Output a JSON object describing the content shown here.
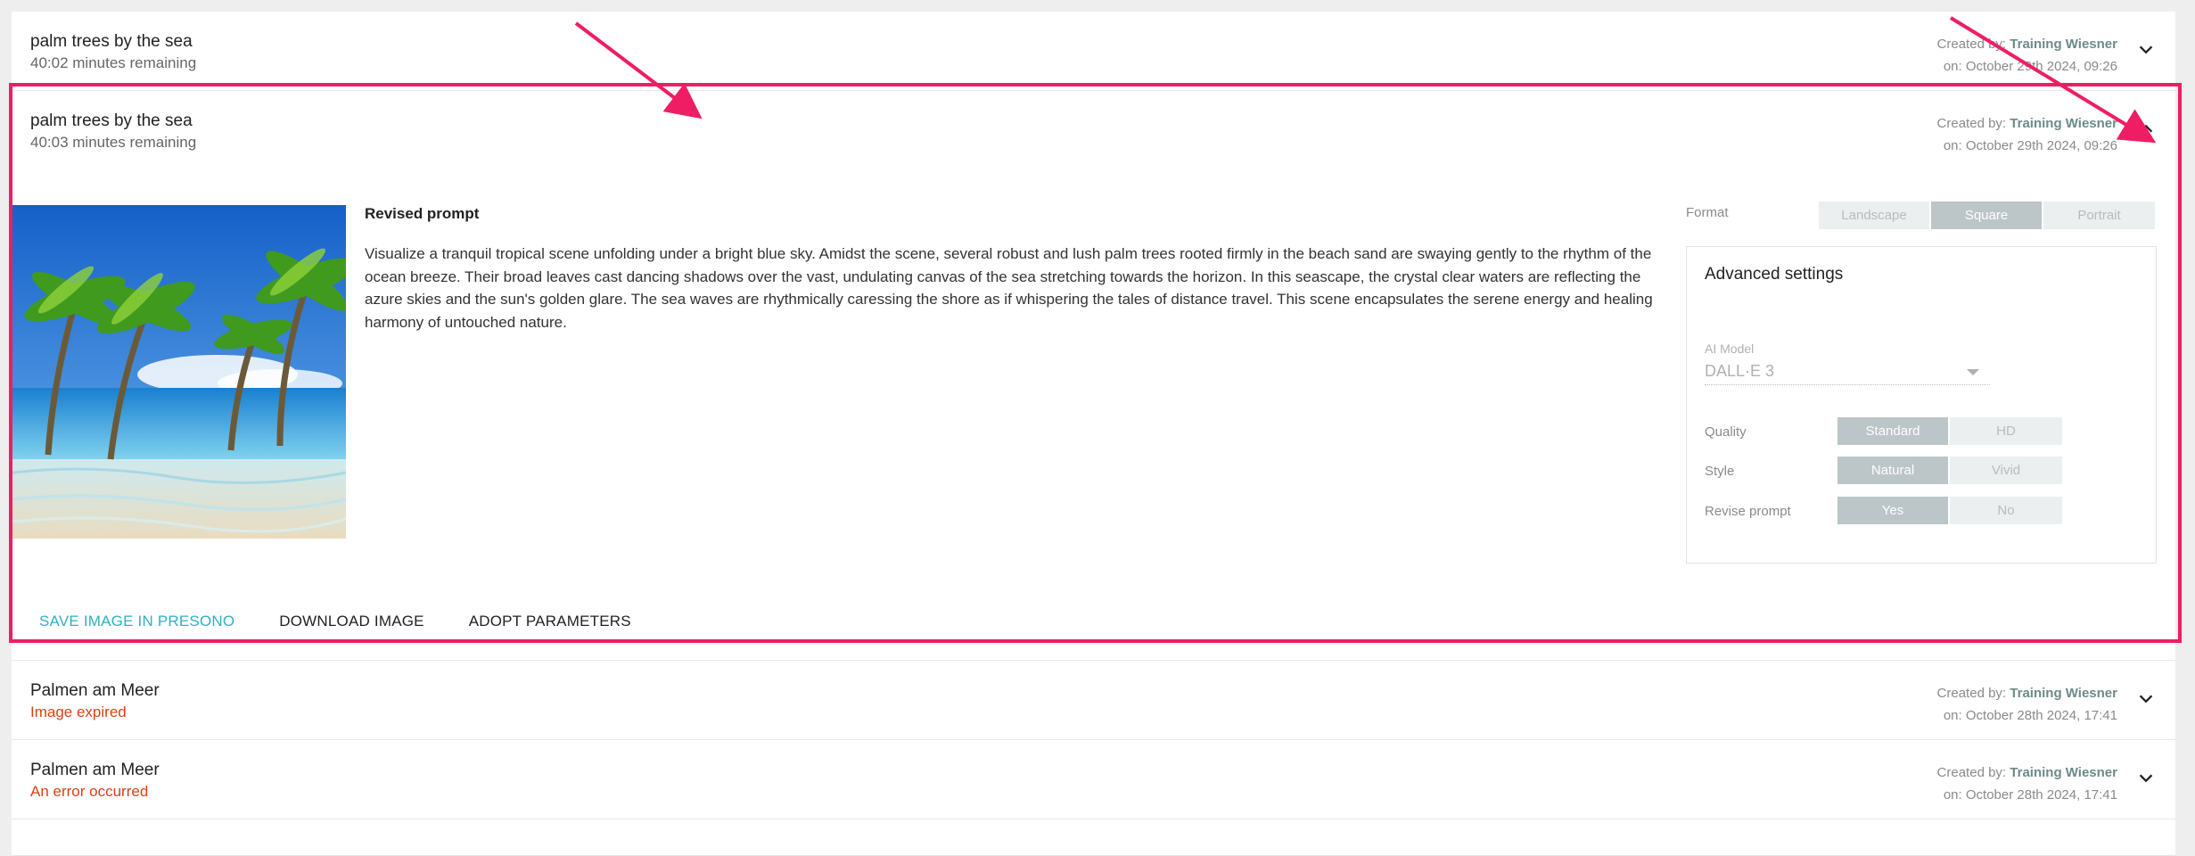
{
  "items": [
    {
      "title": "palm trees by the sea",
      "subtitle": "40:02 minutes remaining",
      "created_label": "Created by:",
      "creator": "Training Wiesner",
      "date": "on: October 29th 2024, 09:26"
    },
    {
      "title": "palm trees by the sea",
      "subtitle": "40:03 minutes remaining",
      "created_label": "Created by:",
      "creator": "Training Wiesner",
      "date": "on: October 29th 2024, 09:26"
    },
    {
      "title": "Palmen am Meer",
      "subtitle": "Image expired",
      "created_label": "Created by:",
      "creator": "Training Wiesner",
      "date": "on: October 28th 2024, 17:41"
    },
    {
      "title": "Palmen am Meer",
      "subtitle": "An error occurred",
      "created_label": "Created by:",
      "creator": "Training Wiesner",
      "date": "on: October 28th 2024, 17:41"
    }
  ],
  "detail": {
    "revised_prompt_title": "Revised prompt",
    "revised_prompt_text": "Visualize a tranquil tropical scene unfolding under a bright blue sky. Amidst the scene, several robust and lush palm trees rooted firmly in the beach sand are swaying gently to the rhythm of the ocean breeze. Their broad leaves cast dancing shadows over the vast, undulating canvas of the sea stretching towards the horizon. In this seascape, the crystal clear waters are reflecting the azure skies and the sun's golden glare. The sea waves are rhythmically caressing the shore as if whispering the tales of distance travel. This scene encapsulates the serene energy and healing harmony of untouched nature.",
    "format_label": "Format",
    "format_options": [
      "Landscape",
      "Square",
      "Portrait"
    ],
    "format_selected": "Square",
    "advanced_title": "Advanced settings",
    "model_label": "AI Model",
    "model_value": "DALL·E 3",
    "quality_label": "Quality",
    "quality_options": [
      "Standard",
      "HD"
    ],
    "style_label": "Style",
    "style_options": [
      "Natural",
      "Vivid"
    ],
    "revise_label": "Revise prompt",
    "revise_options": [
      "Yes",
      "No"
    ],
    "actions": {
      "save": "SAVE IMAGE IN PRESONO",
      "download": "DOWNLOAD IMAGE",
      "adopt": "ADOPT PARAMETERS"
    }
  },
  "colors": {
    "highlight": "#ee1d64",
    "accent": "#2fb1c2",
    "error": "#d84315"
  }
}
